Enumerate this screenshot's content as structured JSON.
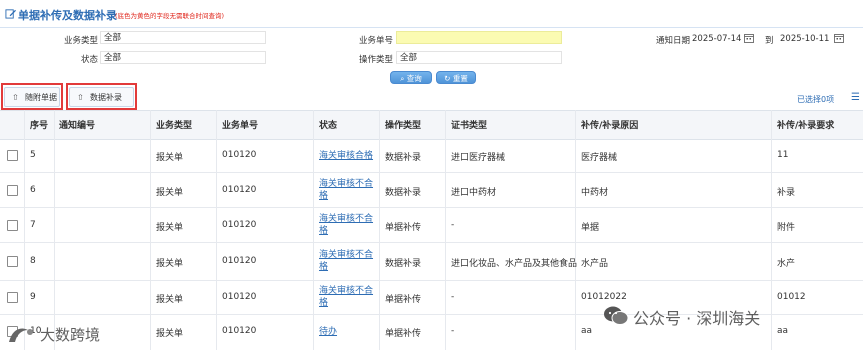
{
  "title": "单据补传及数据补录",
  "title_note": "(底色为黄色的字段无需联合时间查询)",
  "filters": {
    "business_type_label": "业务类型",
    "business_type_value": "全部",
    "status_label": "状态",
    "status_value": "全部",
    "business_no_label": "业务单号",
    "business_no_value": "",
    "operation_type_label": "操作类型",
    "operation_type_value": "全部",
    "notice_date_label": "通知日期",
    "date_from": "2025-07-14",
    "date_to_label": "到",
    "date_to": "2025-10-11"
  },
  "buttons": {
    "search": "查询",
    "reset": "重置",
    "attach_docs": "随附单据",
    "data_supplement": "数据补录"
  },
  "selected_text": "已选择0项",
  "columns": [
    "序号",
    "通知编号",
    "业务类型",
    "业务单号",
    "状态",
    "操作类型",
    "证书类型",
    "补传/补录原因",
    "补传/补录要求"
  ],
  "rows": [
    {
      "seq": "5",
      "notice": "",
      "btype": "报关单",
      "bno": "010120",
      "status": "海关审核合格",
      "op": "数据补录",
      "cert": "进口医疗器械",
      "reason": "医疗器械",
      "req": "11"
    },
    {
      "seq": "6",
      "notice": "",
      "btype": "报关单",
      "bno": "010120",
      "status": "海关审核不合格",
      "op": "数据补录",
      "cert": "进口中药材",
      "reason": "中药材",
      "req": "补录"
    },
    {
      "seq": "7",
      "notice": "",
      "btype": "报关单",
      "bno": "010120",
      "status": "海关审核不合格",
      "op": "单据补传",
      "cert": "-",
      "reason": "单据",
      "req": "附件"
    },
    {
      "seq": "8",
      "notice": "",
      "btype": "报关单",
      "bno": "010120",
      "status": "海关审核不合格",
      "op": "数据补录",
      "cert": "进口化妆品、水产品及其他食品",
      "reason": "水产品",
      "req": "水产"
    },
    {
      "seq": "9",
      "notice": "",
      "btype": "报关单",
      "bno": "010120",
      "status": "海关审核不合格",
      "op": "单据补传",
      "cert": "-",
      "reason": "01012022",
      "req": "01012"
    },
    {
      "seq": "10",
      "notice": "",
      "btype": "报关单",
      "bno": "010120",
      "status": "待办",
      "op": "单据补传",
      "cert": "-",
      "reason": "aa",
      "req": "aa"
    }
  ],
  "watermarks": {
    "left": "大数跨境",
    "right": "公众号 · 深圳海关"
  }
}
